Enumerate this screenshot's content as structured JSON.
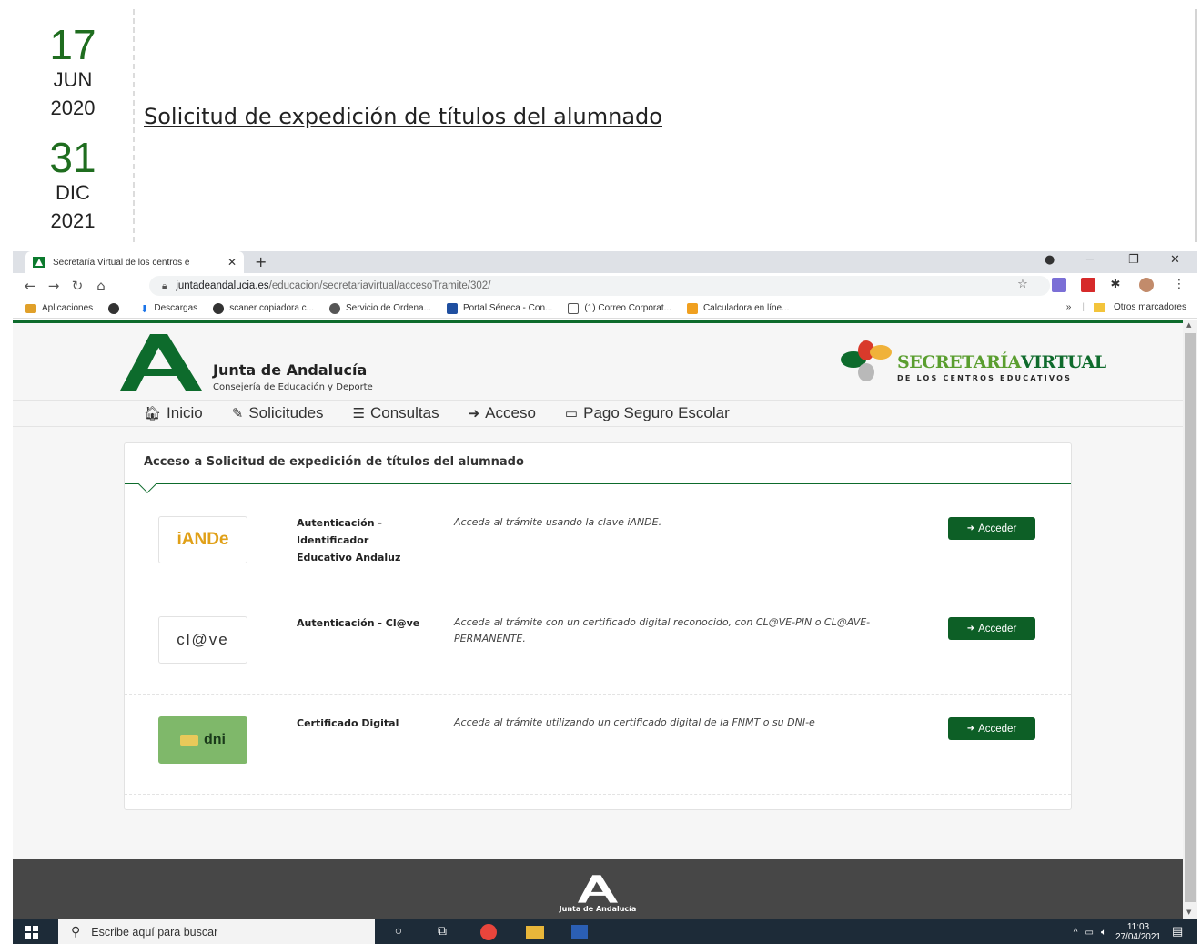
{
  "announcement": {
    "start": {
      "day": "17",
      "month": "JUN",
      "year": "2020"
    },
    "end": {
      "day": "31",
      "month": "DIC",
      "year": "2021"
    },
    "link_text": "Solicitud de expedición de títulos del alumnado"
  },
  "browser": {
    "tab_title": "Secretaría Virtual de los centros e",
    "url_host": "juntadeandalucia.es",
    "url_path": "/educacion/secretariavirtual/accesoTramite/302/",
    "bookmarks": [
      {
        "label": "Aplicaciones"
      },
      {
        "label": ""
      },
      {
        "label": "Descargas"
      },
      {
        "label": "scaner copiadora c..."
      },
      {
        "label": "Servicio de Ordena..."
      },
      {
        "label": "Portal Séneca - Con..."
      },
      {
        "label": "(1) Correo Corporat..."
      },
      {
        "label": "Calculadora en líne..."
      }
    ],
    "bookmarks_more": "»",
    "other_bookmarks": "Otros marcadores"
  },
  "site": {
    "org_name": "Junta de Andalucía",
    "org_sub": "Consejería de Educación y Deporte",
    "sv_title_a": "SECRETARÍA",
    "sv_title_b": "VIRTUAL",
    "sv_sub": "DE LOS CENTROS EDUCATIVOS",
    "nav": [
      {
        "label": "Inicio",
        "icon": "home-icon"
      },
      {
        "label": "Solicitudes",
        "icon": "pencil-icon"
      },
      {
        "label": "Consultas",
        "icon": "list-icon"
      },
      {
        "label": "Acceso",
        "icon": "sign-in-icon"
      },
      {
        "label": "Pago Seguro Escolar",
        "icon": "credit-card-icon"
      }
    ],
    "panel_title": "Acceso a Solicitud de expedición de títulos del alumnado",
    "methods": [
      {
        "name": "Autenticación - Identificador Educativo Andaluz",
        "desc": "Acceda al trámite usando la clave iANDE.",
        "button": "Acceder",
        "logo": "iANDe"
      },
      {
        "name": "Autenticación - Cl@ve",
        "desc": "Acceda al trámite con un certificado digital reconocido, con CL@VE-PIN o CL@AVE-PERMANENTE.",
        "button": "Acceder",
        "logo": "cl@ve"
      },
      {
        "name": "Certificado Digital",
        "desc": "Acceda al trámite utilizando un certificado digital de la FNMT o su DNI-e",
        "button": "Acceder",
        "logo": "dni"
      }
    ],
    "footer_text": "Junta de Andalucía"
  },
  "taskbar": {
    "search_placeholder": "Escribe aquí para buscar",
    "time": "11:03",
    "date": "27/04/2021"
  },
  "colors": {
    "brand_green": "#0d6b2c",
    "date_green": "#1f6d1f",
    "sv_light_green": "#5a9e2f"
  }
}
